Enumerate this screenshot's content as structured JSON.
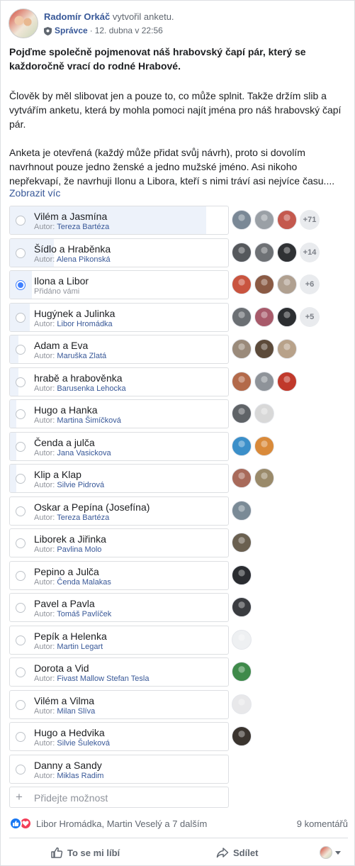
{
  "post": {
    "author": "Radomír Orkáč",
    "action": "vytvořil anketu.",
    "role": "Správce",
    "date": "12. dubna v 22:56",
    "title": "Pojďme společně pojmenovat náš hrabovský čapí pár, který se každoročně vrací do rodné Hrabové.",
    "paragraph1": "Člověk by měl slibovat jen a pouze to, co může splnit. Takže držím slib a vytvářím anketu, která by mohla pomoci najít jména pro náš hrabovský čapí pár.",
    "paragraph2": "Anketa je otevřená (každý může přidat svůj návrh), proto si dovolím navrhnout pouze jedno ženské a jedno mužské jméno. Asi nikoho nepřekvapí, že navrhuji Ilonu a Libora, kteří s nimi tráví asi nejvíce času....",
    "see_more": "Zobrazit víc"
  },
  "poll": {
    "author_prefix": "Autor:",
    "options": [
      {
        "title": "Vilém a Jasmína",
        "author": "Tereza Bartéza",
        "voters": 3,
        "more": "+71",
        "fill": 0.9,
        "checked": false,
        "colors": [
          "#7a8896",
          "#9aa0a6",
          "#c4594e"
        ]
      },
      {
        "title": "Šídlo a Hraběnka",
        "author": "Alena Pikonská",
        "voters": 3,
        "more": "+14",
        "fill": 0.2,
        "checked": false,
        "colors": [
          "#55585c",
          "#6e7175",
          "#2f3134"
        ]
      },
      {
        "title": "Ilona a Libor",
        "author": "",
        "added_by_you": "Přidáno vámi",
        "voters": 3,
        "more": "+6",
        "fill": 0.1,
        "checked": true,
        "colors": [
          "#c9543f",
          "#8a5a44",
          "#b0a090"
        ]
      },
      {
        "title": "Hugýnek a Julinka",
        "author": "Libor Hromádka",
        "voters": 3,
        "more": "+5",
        "fill": 0.09,
        "checked": false,
        "colors": [
          "#6b6f73",
          "#a85a6a",
          "#2c2e31"
        ]
      },
      {
        "title": "Adam a Eva",
        "author": "Maruška Zlatá",
        "voters": 3,
        "more": "",
        "fill": 0.04,
        "checked": false,
        "colors": [
          "#9a8a7a",
          "#5c4a3a",
          "#b8a28a"
        ]
      },
      {
        "title": "hrabě a hrabověnka",
        "author": "Barusenka Lehocka",
        "voters": 3,
        "more": "",
        "fill": 0.04,
        "checked": false,
        "colors": [
          "#b36a4a",
          "#8e9399",
          "#c0392b"
        ]
      },
      {
        "title": "Hugo a Hanka",
        "author": "Martina Šimíčková",
        "voters": 2,
        "more": "",
        "fill": 0.03,
        "checked": false,
        "colors": [
          "#5f6367",
          "#d8d8d8"
        ]
      },
      {
        "title": "Čenda a julča",
        "author": "Jana Vasickova",
        "voters": 2,
        "more": "",
        "fill": 0.03,
        "checked": false,
        "colors": [
          "#3b8fc9",
          "#d98a3a"
        ]
      },
      {
        "title": "Klip a Klap",
        "author": "Silvie Pidrová",
        "voters": 2,
        "more": "",
        "fill": 0.03,
        "checked": false,
        "colors": [
          "#a86a5a",
          "#9a8a6a"
        ]
      },
      {
        "title": "Oskar a Pepína (Josefína)",
        "author": "Tereza Bartéza",
        "voters": 1,
        "more": "",
        "fill": 0.0,
        "checked": false,
        "colors": [
          "#7a8a96"
        ]
      },
      {
        "title": "Liborek a Jiřinka",
        "author": "Pavlina Molo",
        "voters": 1,
        "more": "",
        "fill": 0.0,
        "checked": false,
        "colors": [
          "#6a6050"
        ]
      },
      {
        "title": "Pepino a Julča",
        "author": "Čenda Malakas",
        "voters": 1,
        "more": "",
        "fill": 0.0,
        "checked": false,
        "colors": [
          "#2a2c30"
        ]
      },
      {
        "title": "Pavel a Pavla",
        "author": "Tomáš Pavlíček",
        "voters": 1,
        "more": "",
        "fill": 0.0,
        "checked": false,
        "colors": [
          "#3a3c40"
        ]
      },
      {
        "title": "Pepík a Helenka",
        "author": "Martin Legart",
        "voters": 1,
        "more": "",
        "fill": 0.0,
        "checked": false,
        "colors": [
          "#eef0f2"
        ]
      },
      {
        "title": "Dorota a Vid",
        "author": "Fivast Mallow Stefan Tesla",
        "voters": 1,
        "more": "",
        "fill": 0.0,
        "checked": false,
        "colors": [
          "#3f8a4a"
        ]
      },
      {
        "title": "Vilém a Vilma",
        "author": "Milan Slíva",
        "voters": 1,
        "more": "",
        "fill": 0.0,
        "checked": false,
        "colors": [
          "#e8e8ea"
        ]
      },
      {
        "title": "Hugo a Hedvika",
        "author": "Silvie Šuleková",
        "voters": 1,
        "more": "",
        "fill": 0.0,
        "checked": false,
        "colors": [
          "#3a342e"
        ]
      },
      {
        "title": "Danny a Sandy",
        "author": "Miklas Radim",
        "voters": 0,
        "more": "",
        "fill": 0.0,
        "checked": false,
        "colors": []
      }
    ],
    "add_placeholder": "Přidejte možnost"
  },
  "reactions": {
    "names": "Libor Hromádka, Martin Veselý a 7 dalším",
    "comments": "9 komentářů"
  },
  "actions": {
    "like": "To se mi líbí",
    "share": "Sdílet"
  },
  "colors": {
    "link": "#385898",
    "accent": "#4080ff",
    "muted": "#90949c"
  }
}
